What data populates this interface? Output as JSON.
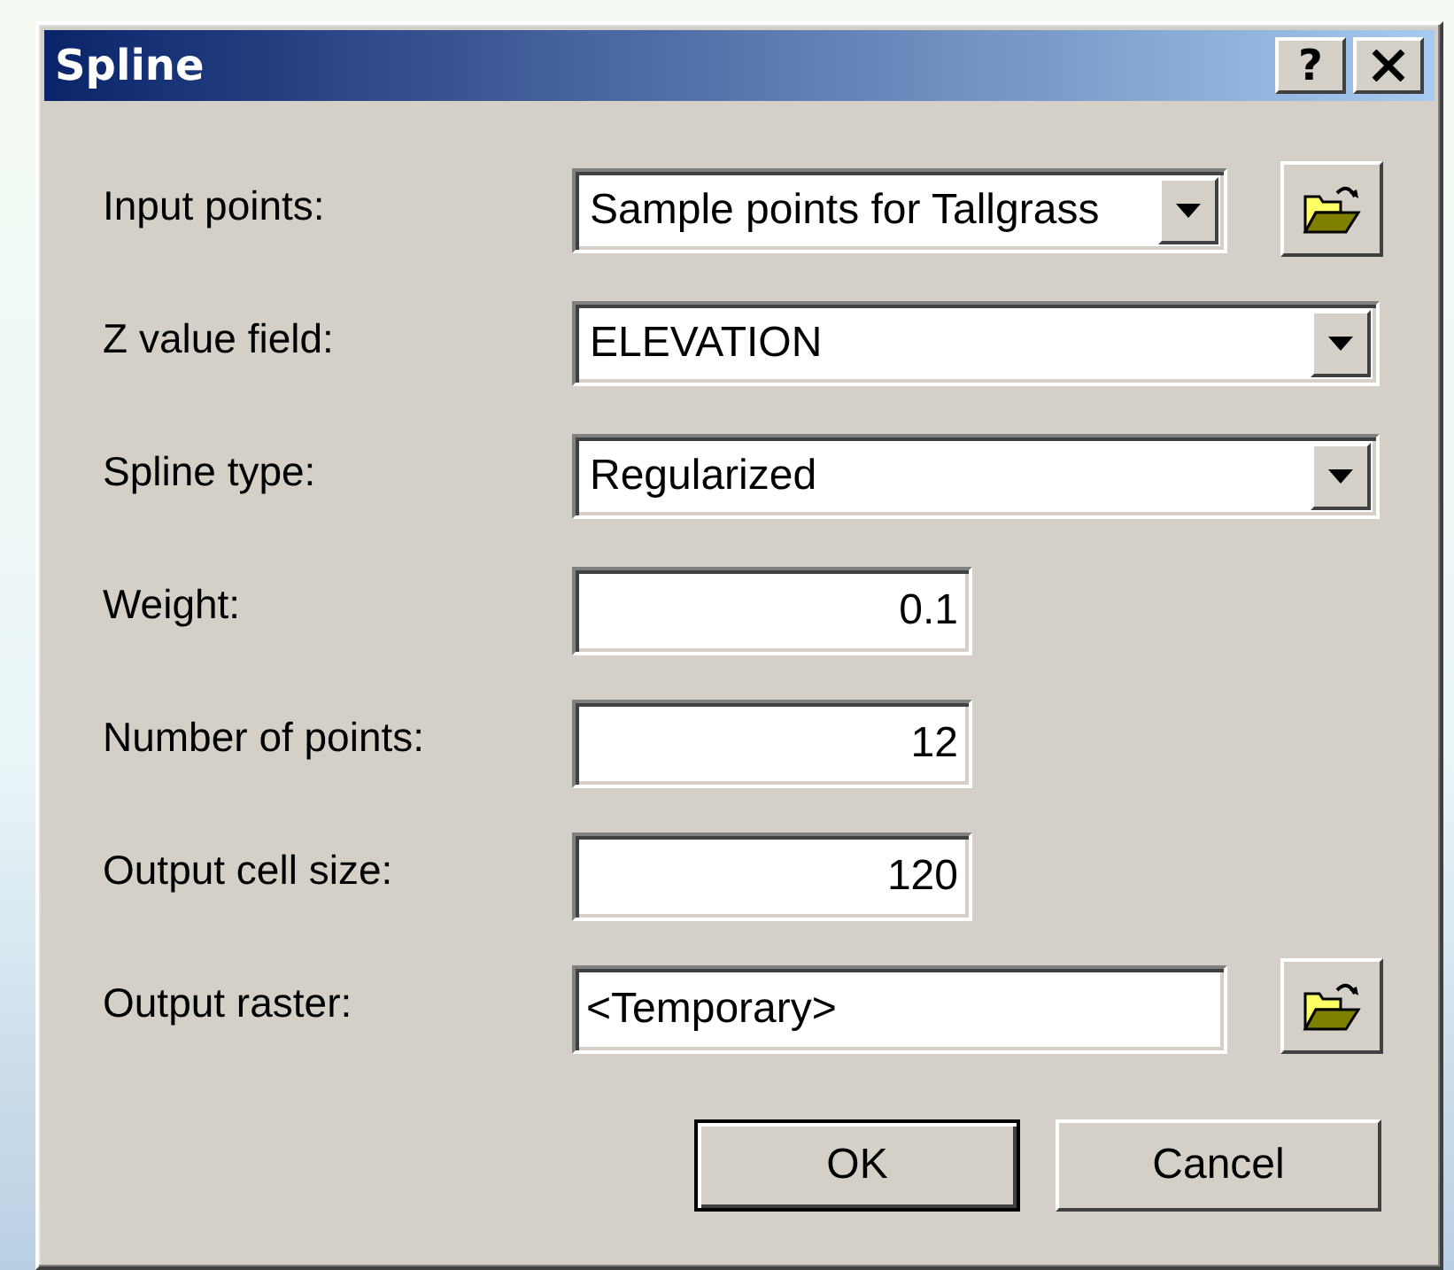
{
  "window": {
    "title": "Spline",
    "help_button": "?"
  },
  "fields": [
    {
      "label": "Input points:",
      "kind": "combo",
      "value": "Sample points for Tallgrass",
      "browse": true
    },
    {
      "label": "Z value field:",
      "kind": "combo",
      "value": "ELEVATION",
      "browse": false
    },
    {
      "label": "Spline type:",
      "kind": "combo",
      "value": "Regularized",
      "browse": false
    },
    {
      "label": "Weight:",
      "kind": "number",
      "value": "0.1",
      "browse": false
    },
    {
      "label": "Number of points:",
      "kind": "number",
      "value": "12",
      "browse": false
    },
    {
      "label": "Output cell size:",
      "kind": "number",
      "value": "120",
      "browse": false
    },
    {
      "label": "Output raster:",
      "kind": "text",
      "value": "<Temporary>",
      "browse": true
    }
  ],
  "buttons": [
    {
      "label": "OK",
      "default": true
    },
    {
      "label": "Cancel",
      "default": false
    }
  ]
}
